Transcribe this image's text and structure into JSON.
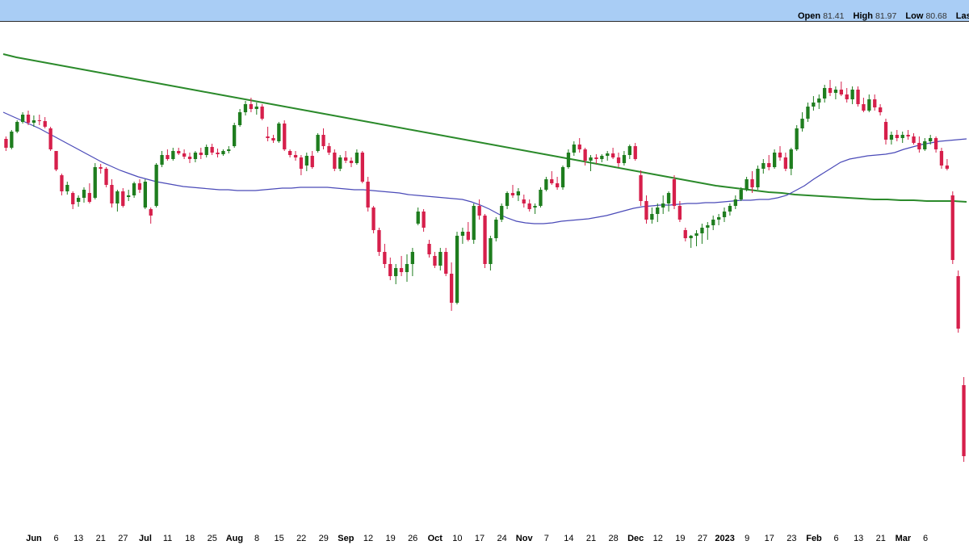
{
  "header": {
    "open_label": "Open",
    "open_value": "81.41",
    "high_label": "High",
    "high_value": "81.97",
    "low_label": "Low",
    "low_value": "80.68",
    "last_label": "Last"
  },
  "colors": {
    "up": "#1e7d1e",
    "down": "#d61f4b",
    "ma_long": "#2b8a2b",
    "ma_short": "#4a4ab8",
    "header_bg": "#a9cdf5"
  },
  "chart_data": {
    "type": "candlestick",
    "x_tick_labels": [
      "Jun",
      "6",
      "13",
      "21",
      "27",
      "Jul",
      "11",
      "18",
      "25",
      "Aug",
      "8",
      "15",
      "22",
      "29",
      "Sep",
      "12",
      "19",
      "26",
      "Oct",
      "10",
      "17",
      "24",
      "Nov",
      "7",
      "14",
      "21",
      "28",
      "Dec",
      "12",
      "19",
      "27",
      "2023",
      "9",
      "17",
      "23",
      "Feb",
      "6",
      "13",
      "21",
      "Mar",
      "6"
    ],
    "month_labels": [
      "Jun",
      "Jul",
      "Aug",
      "Sep",
      "Oct",
      "Nov",
      "Dec",
      "2023",
      "Feb",
      "Mar"
    ],
    "grid": false,
    "candles": [
      {
        "o": 75,
        "h": 78,
        "l": 60,
        "c": 64
      },
      {
        "o": 64,
        "h": 86,
        "l": 62,
        "c": 84
      },
      {
        "o": 84,
        "h": 98,
        "l": 82,
        "c": 96
      },
      {
        "o": 96,
        "h": 108,
        "l": 94,
        "c": 105
      },
      {
        "o": 105,
        "h": 110,
        "l": 92,
        "c": 95
      },
      {
        "o": 95,
        "h": 104,
        "l": 90,
        "c": 98
      },
      {
        "o": 98,
        "h": 105,
        "l": 92,
        "c": 97
      },
      {
        "o": 97,
        "h": 102,
        "l": 88,
        "c": 90
      },
      {
        "o": 88,
        "h": 90,
        "l": 60,
        "c": 62
      },
      {
        "o": 60,
        "h": 58,
        "l": 35,
        "c": 37
      },
      {
        "o": 30,
        "h": 32,
        "l": 5,
        "c": 10
      },
      {
        "o": 10,
        "h": 22,
        "l": 6,
        "c": 18
      },
      {
        "o": 8,
        "h": 10,
        "l": -12,
        "c": -6
      },
      {
        "o": -3,
        "h": 5,
        "l": -9,
        "c": 2
      },
      {
        "o": 2,
        "h": 15,
        "l": -4,
        "c": 12
      },
      {
        "o": 8,
        "h": 20,
        "l": -5,
        "c": -3
      },
      {
        "o": 2,
        "h": 45,
        "l": 0,
        "c": 40
      },
      {
        "o": 40,
        "h": 44,
        "l": 32,
        "c": 38
      },
      {
        "o": 38,
        "h": 40,
        "l": 15,
        "c": 18
      },
      {
        "o": 18,
        "h": 25,
        "l": -10,
        "c": -5
      },
      {
        "o": -5,
        "h": 12,
        "l": -15,
        "c": 10
      },
      {
        "o": 10,
        "h": 14,
        "l": -10,
        "c": -8
      },
      {
        "o": 3,
        "h": 12,
        "l": -2,
        "c": 5
      },
      {
        "o": 5,
        "h": 22,
        "l": 2,
        "c": 20
      },
      {
        "o": 20,
        "h": 25,
        "l": 8,
        "c": 12
      },
      {
        "o": -10,
        "h": 25,
        "l": -12,
        "c": 22
      },
      {
        "o": -12,
        "h": -10,
        "l": -30,
        "c": -20
      },
      {
        "o": -8,
        "h": 45,
        "l": -10,
        "c": 43
      },
      {
        "o": 43,
        "h": 60,
        "l": 40,
        "c": 55
      },
      {
        "o": 55,
        "h": 62,
        "l": 48,
        "c": 50
      },
      {
        "o": 50,
        "h": 64,
        "l": 48,
        "c": 60
      },
      {
        "o": 60,
        "h": 64,
        "l": 55,
        "c": 57
      },
      {
        "o": 57,
        "h": 62,
        "l": 50,
        "c": 53
      },
      {
        "o": 53,
        "h": 58,
        "l": 45,
        "c": 50
      },
      {
        "o": 50,
        "h": 60,
        "l": 46,
        "c": 58
      },
      {
        "o": 58,
        "h": 64,
        "l": 50,
        "c": 55
      },
      {
        "o": 55,
        "h": 68,
        "l": 52,
        "c": 65
      },
      {
        "o": 65,
        "h": 69,
        "l": 55,
        "c": 58
      },
      {
        "o": 58,
        "h": 63,
        "l": 52,
        "c": 56
      },
      {
        "o": 56,
        "h": 62,
        "l": 54,
        "c": 60
      },
      {
        "o": 60,
        "h": 66,
        "l": 57,
        "c": 62
      },
      {
        "o": 66,
        "h": 95,
        "l": 64,
        "c": 92
      },
      {
        "o": 92,
        "h": 112,
        "l": 90,
        "c": 108
      },
      {
        "o": 108,
        "h": 122,
        "l": 104,
        "c": 118
      },
      {
        "o": 118,
        "h": 126,
        "l": 108,
        "c": 112
      },
      {
        "o": 112,
        "h": 120,
        "l": 105,
        "c": 115
      },
      {
        "o": 115,
        "h": 118,
        "l": 98,
        "c": 100
      },
      {
        "o": 78,
        "h": 90,
        "l": 72,
        "c": 76
      },
      {
        "o": 76,
        "h": 80,
        "l": 70,
        "c": 73
      },
      {
        "o": 72,
        "h": 96,
        "l": 70,
        "c": 94
      },
      {
        "o": 94,
        "h": 98,
        "l": 60,
        "c": 62
      },
      {
        "o": 60,
        "h": 62,
        "l": 52,
        "c": 55
      },
      {
        "o": 55,
        "h": 60,
        "l": 48,
        "c": 52
      },
      {
        "o": 52,
        "h": 55,
        "l": 30,
        "c": 38
      },
      {
        "o": 42,
        "h": 58,
        "l": 35,
        "c": 54
      },
      {
        "o": 54,
        "h": 60,
        "l": 38,
        "c": 40
      },
      {
        "o": 60,
        "h": 82,
        "l": 58,
        "c": 80
      },
      {
        "o": 80,
        "h": 88,
        "l": 62,
        "c": 66
      },
      {
        "o": 66,
        "h": 70,
        "l": 55,
        "c": 58
      },
      {
        "o": 58,
        "h": 62,
        "l": 35,
        "c": 38
      },
      {
        "o": 38,
        "h": 55,
        "l": 35,
        "c": 52
      },
      {
        "o": 52,
        "h": 60,
        "l": 45,
        "c": 48
      },
      {
        "o": 48,
        "h": 52,
        "l": 40,
        "c": 45
      },
      {
        "o": 45,
        "h": 62,
        "l": 43,
        "c": 58
      },
      {
        "o": 58,
        "h": 60,
        "l": 20,
        "c": 22
      },
      {
        "o": 22,
        "h": 28,
        "l": -15,
        "c": -10
      },
      {
        "o": -10,
        "h": -8,
        "l": -42,
        "c": -38
      },
      {
        "o": -38,
        "h": -35,
        "l": -70,
        "c": -65
      },
      {
        "o": -65,
        "h": -55,
        "l": -85,
        "c": -80
      },
      {
        "o": -80,
        "h": -72,
        "l": -100,
        "c": -95
      },
      {
        "o": -95,
        "h": -80,
        "l": -105,
        "c": -85
      },
      {
        "o": -85,
        "h": -70,
        "l": -95,
        "c": -90
      },
      {
        "o": -90,
        "h": -68,
        "l": -102,
        "c": -80
      },
      {
        "o": -80,
        "h": -60,
        "l": -95,
        "c": -65
      },
      {
        "o": -30,
        "h": -10,
        "l": -32,
        "c": -15
      },
      {
        "o": -15,
        "h": -12,
        "l": -40,
        "c": -35
      },
      {
        "o": -55,
        "h": -50,
        "l": -72,
        "c": -68
      },
      {
        "o": -70,
        "h": -65,
        "l": -85,
        "c": -82
      },
      {
        "o": -82,
        "h": -60,
        "l": -88,
        "c": -65
      },
      {
        "o": -65,
        "h": -60,
        "l": -95,
        "c": -92
      },
      {
        "o": -92,
        "h": -78,
        "l": -138,
        "c": -128
      },
      {
        "o": -128,
        "h": -40,
        "l": -130,
        "c": -45
      },
      {
        "o": -45,
        "h": -35,
        "l": -55,
        "c": -40
      },
      {
        "o": -40,
        "h": -28,
        "l": -52,
        "c": -50
      },
      {
        "o": -50,
        "h": -5,
        "l": -55,
        "c": -8
      },
      {
        "o": -8,
        "h": 0,
        "l": -25,
        "c": -20
      },
      {
        "o": -20,
        "h": -18,
        "l": -85,
        "c": -80
      },
      {
        "o": -80,
        "h": -45,
        "l": -88,
        "c": -48
      },
      {
        "o": -48,
        "h": -22,
        "l": -52,
        "c": -25
      },
      {
        "o": -25,
        "h": -5,
        "l": -28,
        "c": -8
      },
      {
        "o": -8,
        "h": 10,
        "l": -12,
        "c": 8
      },
      {
        "o": 8,
        "h": 18,
        "l": 2,
        "c": 5
      },
      {
        "o": 5,
        "h": 14,
        "l": -2,
        "c": 10
      },
      {
        "o": 0,
        "h": 6,
        "l": -10,
        "c": -5
      },
      {
        "o": -5,
        "h": 0,
        "l": -15,
        "c": -12
      },
      {
        "o": -10,
        "h": -5,
        "l": -18,
        "c": -8
      },
      {
        "o": -8,
        "h": 15,
        "l": -10,
        "c": 12
      },
      {
        "o": 12,
        "h": 28,
        "l": 10,
        "c": 25
      },
      {
        "o": 25,
        "h": 35,
        "l": 18,
        "c": 20
      },
      {
        "o": 20,
        "h": 28,
        "l": 12,
        "c": 15
      },
      {
        "o": 15,
        "h": 42,
        "l": 12,
        "c": 40
      },
      {
        "o": 40,
        "h": 62,
        "l": 38,
        "c": 58
      },
      {
        "o": 58,
        "h": 72,
        "l": 54,
        "c": 68
      },
      {
        "o": 68,
        "h": 76,
        "l": 58,
        "c": 62
      },
      {
        "o": 62,
        "h": 64,
        "l": 42,
        "c": 48
      },
      {
        "o": 48,
        "h": 55,
        "l": 35,
        "c": 52
      },
      {
        "o": 52,
        "h": 56,
        "l": 44,
        "c": 50
      },
      {
        "o": 50,
        "h": 56,
        "l": 46,
        "c": 54
      },
      {
        "o": 54,
        "h": 60,
        "l": 48,
        "c": 57
      },
      {
        "o": 57,
        "h": 64,
        "l": 50,
        "c": 52
      },
      {
        "o": 52,
        "h": 58,
        "l": 40,
        "c": 45
      },
      {
        "o": 45,
        "h": 60,
        "l": 42,
        "c": 55
      },
      {
        "o": 55,
        "h": 68,
        "l": 50,
        "c": 66
      },
      {
        "o": 66,
        "h": 70,
        "l": 48,
        "c": 50
      },
      {
        "o": 30,
        "h": 36,
        "l": -8,
        "c": -2
      },
      {
        "o": -2,
        "h": 5,
        "l": -30,
        "c": -25
      },
      {
        "o": -25,
        "h": -10,
        "l": -30,
        "c": -18
      },
      {
        "o": -18,
        "h": -5,
        "l": -28,
        "c": -10
      },
      {
        "o": -10,
        "h": 5,
        "l": -18,
        "c": -5
      },
      {
        "o": -5,
        "h": 10,
        "l": -15,
        "c": 8
      },
      {
        "o": 25,
        "h": 30,
        "l": -12,
        "c": -8
      },
      {
        "o": -8,
        "h": -2,
        "l": -28,
        "c": -25
      },
      {
        "o": -38,
        "h": -35,
        "l": -52,
        "c": -48
      },
      {
        "o": -48,
        "h": -44,
        "l": -60,
        "c": -45
      },
      {
        "o": -45,
        "h": -38,
        "l": -58,
        "c": -42
      },
      {
        "o": -42,
        "h": -30,
        "l": -55,
        "c": -35
      },
      {
        "o": -35,
        "h": -28,
        "l": -50,
        "c": -32
      },
      {
        "o": -32,
        "h": -20,
        "l": -38,
        "c": -25
      },
      {
        "o": -25,
        "h": -18,
        "l": -32,
        "c": -22
      },
      {
        "o": -22,
        "h": -10,
        "l": -28,
        "c": -15
      },
      {
        "o": -15,
        "h": -5,
        "l": -20,
        "c": -8
      },
      {
        "o": -8,
        "h": 5,
        "l": -12,
        "c": 0
      },
      {
        "o": 0,
        "h": 15,
        "l": -2,
        "c": 12
      },
      {
        "o": 12,
        "h": 28,
        "l": 10,
        "c": 25
      },
      {
        "o": 25,
        "h": 35,
        "l": 8,
        "c": 15
      },
      {
        "o": 15,
        "h": 42,
        "l": 12,
        "c": 38
      },
      {
        "o": 38,
        "h": 50,
        "l": 32,
        "c": 45
      },
      {
        "o": 45,
        "h": 55,
        "l": 36,
        "c": 40
      },
      {
        "o": 40,
        "h": 62,
        "l": 38,
        "c": 58
      },
      {
        "o": 58,
        "h": 66,
        "l": 48,
        "c": 52
      },
      {
        "o": 52,
        "h": 58,
        "l": 35,
        "c": 38
      },
      {
        "o": 38,
        "h": 64,
        "l": 30,
        "c": 62
      },
      {
        "o": 62,
        "h": 92,
        "l": 60,
        "c": 88
      },
      {
        "o": 88,
        "h": 108,
        "l": 84,
        "c": 100
      },
      {
        "o": 100,
        "h": 120,
        "l": 96,
        "c": 115
      },
      {
        "o": 115,
        "h": 128,
        "l": 110,
        "c": 120
      },
      {
        "o": 120,
        "h": 130,
        "l": 112,
        "c": 125
      },
      {
        "o": 125,
        "h": 142,
        "l": 120,
        "c": 138
      },
      {
        "o": 138,
        "h": 148,
        "l": 128,
        "c": 132
      },
      {
        "o": 132,
        "h": 140,
        "l": 124,
        "c": 136
      },
      {
        "o": 136,
        "h": 146,
        "l": 128,
        "c": 130
      },
      {
        "o": 130,
        "h": 138,
        "l": 120,
        "c": 124
      },
      {
        "o": 124,
        "h": 140,
        "l": 118,
        "c": 136
      },
      {
        "o": 136,
        "h": 140,
        "l": 115,
        "c": 118
      },
      {
        "o": 118,
        "h": 126,
        "l": 108,
        "c": 110
      },
      {
        "o": 110,
        "h": 130,
        "l": 108,
        "c": 124
      },
      {
        "o": 124,
        "h": 130,
        "l": 110,
        "c": 114
      },
      {
        "o": 114,
        "h": 118,
        "l": 104,
        "c": 108
      },
      {
        "o": 96,
        "h": 100,
        "l": 68,
        "c": 74
      },
      {
        "o": 74,
        "h": 84,
        "l": 68,
        "c": 80
      },
      {
        "o": 80,
        "h": 86,
        "l": 72,
        "c": 76
      },
      {
        "o": 76,
        "h": 84,
        "l": 70,
        "c": 80
      },
      {
        "o": 80,
        "h": 86,
        "l": 74,
        "c": 78
      },
      {
        "o": 78,
        "h": 82,
        "l": 68,
        "c": 70
      },
      {
        "o": 70,
        "h": 78,
        "l": 58,
        "c": 62
      },
      {
        "o": 62,
        "h": 76,
        "l": 60,
        "c": 72
      },
      {
        "o": 72,
        "h": 80,
        "l": 68,
        "c": 76
      },
      {
        "o": 76,
        "h": 78,
        "l": 58,
        "c": 62
      },
      {
        "o": 60,
        "h": 64,
        "l": 38,
        "c": 42
      },
      {
        "o": 42,
        "h": 50,
        "l": 36,
        "c": 38
      },
      {
        "o": 5,
        "h": 10,
        "l": -80,
        "c": -75
      },
      {
        "o": -95,
        "h": -88,
        "l": -165,
        "c": -160
      },
      {
        "o": -230,
        "h": -220,
        "l": -325,
        "c": -318
      }
    ],
    "ma_short": [
      108,
      103,
      98,
      93,
      88,
      82,
      76,
      70,
      64,
      58,
      52,
      46,
      41,
      36,
      32,
      28,
      25,
      22,
      20,
      18,
      16,
      15,
      14,
      13,
      12,
      12,
      11,
      11,
      11,
      12,
      13,
      14,
      14,
      15,
      15,
      15,
      15,
      14,
      13,
      12,
      12,
      11,
      10,
      9,
      8,
      6,
      5,
      4,
      3,
      2,
      1,
      0,
      -3,
      -7,
      -12,
      -18,
      -23,
      -27,
      -29,
      -30,
      -30,
      -29,
      -27,
      -26,
      -25,
      -24,
      -22,
      -20,
      -17,
      -14,
      -11,
      -9,
      -8,
      -7,
      -7,
      -6,
      -5,
      -5,
      -4,
      -4,
      -3,
      -2,
      -1,
      -1,
      0,
      0,
      2,
      5,
      11,
      17,
      25,
      32,
      39,
      46,
      50,
      52,
      54,
      55,
      56,
      58,
      62,
      65,
      68,
      70,
      72,
      73,
      74,
      75
    ],
    "ma_long": [
      180,
      176,
      173,
      170,
      167,
      164,
      161,
      158,
      155,
      152,
      149,
      146,
      143,
      140,
      137,
      134,
      131,
      128,
      125,
      122,
      119,
      116,
      113,
      110,
      107,
      104,
      101,
      98,
      95,
      92,
      89,
      86,
      83,
      80,
      77,
      74,
      71,
      68,
      65,
      62,
      59,
      56,
      53,
      50,
      47,
      44,
      41,
      38,
      35,
      32,
      29,
      26,
      23,
      20,
      17,
      15,
      13,
      11,
      9,
      8,
      6,
      5,
      4,
      3,
      2,
      1,
      0,
      0,
      -1,
      -1,
      -2,
      -2,
      -2,
      -3
    ]
  }
}
